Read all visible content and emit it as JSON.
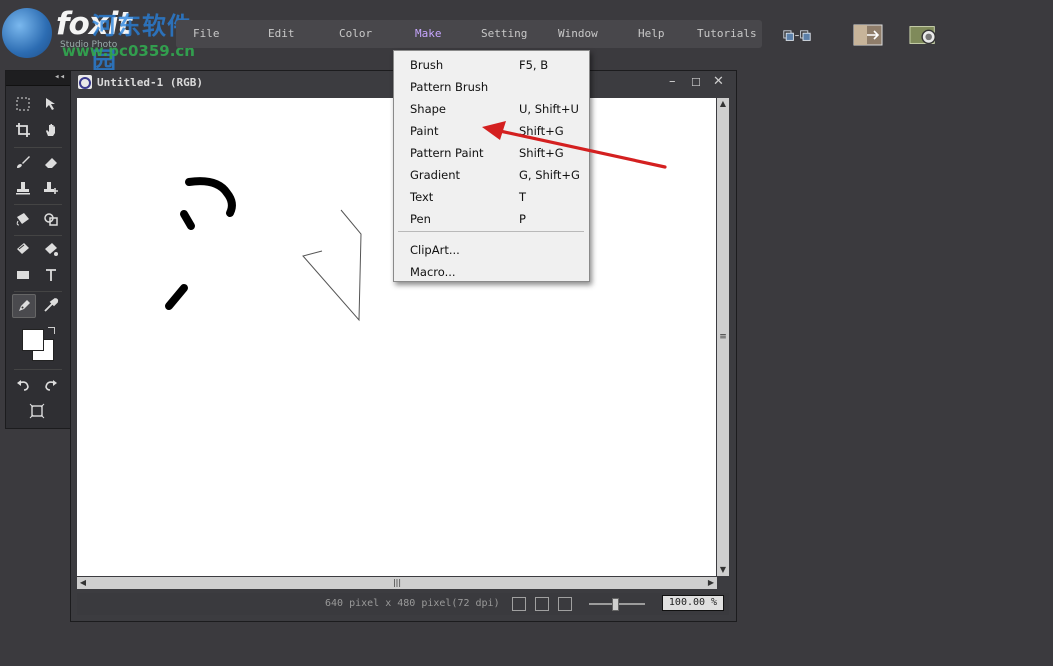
{
  "app": {
    "logo_text": "foxit",
    "logo_sub": "Studio Photo",
    "watermark": "河东软件园",
    "watermark_url": "www.pc0359.cn"
  },
  "menubar": {
    "items": [
      {
        "label": "File"
      },
      {
        "label": "Edit"
      },
      {
        "label": "Color"
      },
      {
        "label": "Make"
      },
      {
        "label": "Setting"
      },
      {
        "label": "Window"
      },
      {
        "label": "Help"
      },
      {
        "label": "Tutorials"
      }
    ],
    "active": "Make"
  },
  "toolbar_icons": [
    "window-cascade-icon",
    "image-resize-icon",
    "camera-lens-icon"
  ],
  "toolbox": {
    "collapse_glyph": "◂◂",
    "tools": [
      "rect-select-icon",
      "move-icon",
      "crop-icon",
      "hand-icon",
      "brush-icon",
      "eraser-icon",
      "stamp-icon",
      "clone-stamp-icon",
      "bucket-icon",
      "shape-select-icon",
      "pattern-brush-icon",
      "fill-icon",
      "rectangle-icon",
      "text-icon",
      "pen-icon",
      "eyedropper-icon",
      "color-swatches",
      "undo-icon",
      "redo-icon",
      "fit-icon"
    ],
    "selected": "pen-icon"
  },
  "document": {
    "title": "Untitled-1 (RGB)",
    "status_text": "640 pixel x 480 pixel(72 dpi)",
    "zoom": "100.00 %",
    "zoom_level": 0.45,
    "win_minimize": "–",
    "win_maximize": "☐",
    "win_close": "✕"
  },
  "make_menu": {
    "items": [
      {
        "label": "Brush",
        "shortcut": "F5, B"
      },
      {
        "label": "Pattern Brush",
        "shortcut": ""
      },
      {
        "label": "Shape",
        "shortcut": "U, Shift+U"
      },
      {
        "label": "Paint",
        "shortcut": "Shift+G"
      },
      {
        "label": "Pattern Paint",
        "shortcut": "Shift+G"
      },
      {
        "label": "Gradient",
        "shortcut": "G, Shift+G"
      },
      {
        "label": "Text",
        "shortcut": "T"
      },
      {
        "label": "Pen",
        "shortcut": "P"
      },
      {
        "label": "ClipArt...",
        "shortcut": ""
      },
      {
        "label": "Macro...",
        "shortcut": ""
      }
    ]
  },
  "colors": {
    "active_menu": "#c7a6ff",
    "annotation_arrow": "#d42020"
  }
}
